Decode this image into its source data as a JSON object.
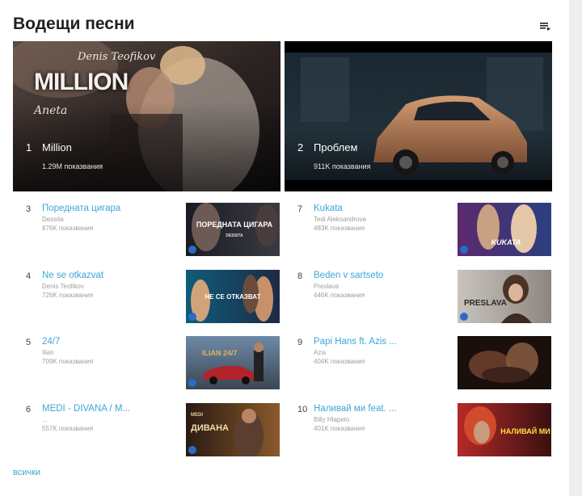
{
  "section": {
    "title": "Водещи песни",
    "menu_icon": "playlist-icon",
    "view_all": "всички"
  },
  "featured": [
    {
      "rank": "1",
      "title": "Million",
      "views": "1.29M показвания",
      "overlay_title": "MILLION",
      "overlay_artist": "Denis Teofikov",
      "overlay_feat": "Aneta",
      "accent": "#b9825a"
    },
    {
      "rank": "2",
      "title": "Проблем",
      "views": "911K показвания",
      "accent": "#c28660"
    }
  ],
  "songs": [
    {
      "rank": "3",
      "title": "Поредната цигара",
      "artist": "Dessita",
      "views": "876K показвания",
      "thumb_text": "ПОРЕДНАТА ЦИГАРА",
      "thumb_sub": "DESSITA"
    },
    {
      "rank": "4",
      "title": "Ne se otkazvat",
      "artist": "Denis Teofikov",
      "views": "726K показвания",
      "thumb_text": "НЕ СЕ ОТКАЗВАТ"
    },
    {
      "rank": "5",
      "title": "24/7",
      "artist": "Ilian",
      "views": "709K показвания",
      "thumb_text": "ILIAN 24/7"
    },
    {
      "rank": "6",
      "title": "MEDI - DIVANA / M...",
      "artist": "...",
      "views": "557K показвания",
      "thumb_text": "ДИВАНА",
      "thumb_sub": "MEDI"
    },
    {
      "rank": "7",
      "title": "Kukata",
      "artist": "Tedi Aleksandrova",
      "views": "483K показвания",
      "thumb_text": "KUKATA"
    },
    {
      "rank": "8",
      "title": "Beden v sartseto",
      "artist": "Preslava",
      "views": "446K показвания",
      "thumb_text": "PRESLAVA"
    },
    {
      "rank": "9",
      "title": "Papi Hans ft. Azis ...",
      "artist": "Azis",
      "views": "404K показвания"
    },
    {
      "rank": "10",
      "title": "Наливай ми feat. ...",
      "artist": "Billy Hlapeto",
      "views": "401K показвания",
      "thumb_text": "НАЛИВАЙ МИ"
    }
  ]
}
